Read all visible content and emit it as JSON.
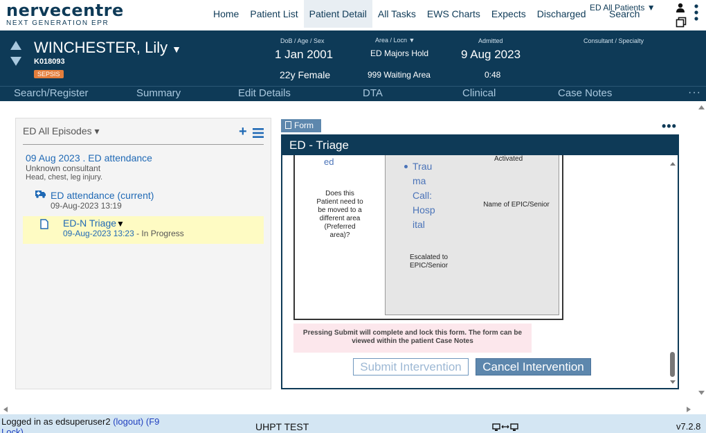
{
  "brand": {
    "name": "nervecentre",
    "tagline": "NEXT GENERATION EPR"
  },
  "nav": {
    "items": [
      "Home",
      "Patient List",
      "Patient Detail",
      "All Tasks",
      "EWS Charts",
      "Expects",
      "Discharged"
    ],
    "active": "Patient Detail",
    "ed_patients": "ED All Patients ▼",
    "search": "Search"
  },
  "patient": {
    "name": "WINCHESTER, Lily",
    "name_caret": "▼",
    "mrn": "K018093",
    "alert": "SEPSIS",
    "dob_label": "DoB / Age / Sex",
    "dob": "1 Jan 2001",
    "age_sex": "22y Female",
    "area_label": "Area / Locn  ▼",
    "area": "ED Majors Hold",
    "location": "999 Waiting Area",
    "admitted_label": "Admitted",
    "admitted": "9 Aug 2023",
    "admitted_time": "0:48",
    "consultant_label": "Consultant / Specialty"
  },
  "subnav": {
    "items": [
      "Search/Register",
      "Summary",
      "Edit Details",
      "DTA",
      "Clinical",
      "Case Notes"
    ],
    "more": "···"
  },
  "episodes": {
    "header": "ED All Episodes ▾",
    "plus": "+",
    "episode_title": "09 Aug 2023 . ED attendance",
    "consultant": "Unknown consultant",
    "complaint": "Head, chest, leg injury.",
    "attendance_title": "ED attendance (current)",
    "attendance_time": "09-Aug-2023 13:19",
    "triage_title": "ED-N Triage",
    "triage_caret": "▼",
    "triage_time": "09-Aug-2023 13:23",
    "triage_status": " - In Progress"
  },
  "form": {
    "tab_label": "Form",
    "dots": "•••",
    "title": "ED - Triage",
    "link_ed": "ed",
    "question": "Does this Patient need to be moved to a different area (Preferred area)?",
    "bullet_lines": [
      "Trau",
      "ma",
      "Call:",
      "Hosp",
      "ital"
    ],
    "activated": "Activated",
    "name_label": "Name of EPIC/Senior",
    "escalated": "Escalated to EPIC/Senior",
    "notice": "Pressing Submit will complete and lock this form. The form can be viewed within the patient Case Notes",
    "submit": "Submit Intervention",
    "cancel": "Cancel Intervention"
  },
  "footer": {
    "logged_in": "Logged in as edsuperuser2 ",
    "logout": "(logout)",
    "f9": "  (F9",
    "lock": "Lock)",
    "env": "UHPT TEST",
    "version": "v7.2.8"
  },
  "colors": {
    "primary": "#0e3a57",
    "accent": "#1f69b5",
    "alert": "#e47e3c",
    "highlight": "#fefbc3",
    "notice": "#fce7ec"
  }
}
